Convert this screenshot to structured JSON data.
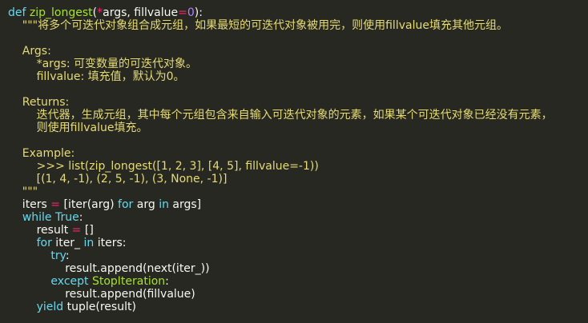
{
  "editor": {
    "background": "#272822",
    "colors": {
      "keyword": "#66d9ef",
      "function": "#a6e22e",
      "number": "#ae81ff",
      "operator": "#f92672",
      "string": "#e6db74",
      "plain": "#f8f8f2"
    },
    "lines": [
      [
        {
          "t": "def",
          "c": "kw"
        },
        {
          "t": " ",
          "c": "plain"
        },
        {
          "t": "zip_longest",
          "c": "fn"
        },
        {
          "t": "(",
          "c": "plain"
        },
        {
          "t": "*",
          "c": "op"
        },
        {
          "t": "args, fillvalue",
          "c": "plain"
        },
        {
          "t": "=",
          "c": "op"
        },
        {
          "t": "0",
          "c": "num"
        },
        {
          "t": "):",
          "c": "plain"
        }
      ],
      [
        {
          "t": "    \"\"\"将多个可迭代对象组合成元组，如果最短的可迭代对象被用完，则使用fillvalue填充其他元组。",
          "c": "str"
        }
      ],
      [],
      [
        {
          "t": "    Args:",
          "c": "str"
        }
      ],
      [
        {
          "t": "        *args: 可变数量的可迭代对象。",
          "c": "str"
        }
      ],
      [
        {
          "t": "        fillvalue: 填充值，默认为0。",
          "c": "str"
        }
      ],
      [],
      [
        {
          "t": "    Returns:",
          "c": "str"
        }
      ],
      [
        {
          "t": "        迭代器，生成元组，其中每个元组包含来自输入可迭代对象的元素，如果某个可迭代对象已经没有元素，",
          "c": "str"
        }
      ],
      [
        {
          "t": "        则使用fillvalue填充。",
          "c": "str"
        }
      ],
      [],
      [
        {
          "t": "    Example:",
          "c": "str"
        }
      ],
      [
        {
          "t": "        >>> list(zip_longest([1, 2, 3], [4, 5], fillvalue=-1))",
          "c": "str"
        }
      ],
      [
        {
          "t": "        [(1, 4, -1), (2, 5, -1), (3, None, -1)]",
          "c": "str"
        }
      ],
      [
        {
          "t": "    \"\"\"",
          "c": "str"
        }
      ],
      [
        {
          "t": "    iters ",
          "c": "plain"
        },
        {
          "t": "=",
          "c": "op"
        },
        {
          "t": " [iter(arg) ",
          "c": "plain"
        },
        {
          "t": "for",
          "c": "kw"
        },
        {
          "t": " arg ",
          "c": "plain"
        },
        {
          "t": "in",
          "c": "kw"
        },
        {
          "t": " args]",
          "c": "plain"
        }
      ],
      [
        {
          "t": "    ",
          "c": "plain"
        },
        {
          "t": "while",
          "c": "kw"
        },
        {
          "t": " ",
          "c": "plain"
        },
        {
          "t": "True",
          "c": "kw"
        },
        {
          "t": ":",
          "c": "plain"
        }
      ],
      [
        {
          "t": "        result ",
          "c": "plain"
        },
        {
          "t": "=",
          "c": "op"
        },
        {
          "t": " []",
          "c": "plain"
        }
      ],
      [
        {
          "t": "        ",
          "c": "plain"
        },
        {
          "t": "for",
          "c": "kw"
        },
        {
          "t": " iter_ ",
          "c": "plain"
        },
        {
          "t": "in",
          "c": "kw"
        },
        {
          "t": " iters:",
          "c": "plain"
        }
      ],
      [
        {
          "t": "            ",
          "c": "plain"
        },
        {
          "t": "try",
          "c": "kw"
        },
        {
          "t": ":",
          "c": "plain"
        }
      ],
      [
        {
          "t": "                result.append(next(iter_))",
          "c": "plain"
        }
      ],
      [
        {
          "t": "            ",
          "c": "plain"
        },
        {
          "t": "except",
          "c": "kw"
        },
        {
          "t": " ",
          "c": "plain"
        },
        {
          "t": "StopIteration",
          "c": "fn"
        },
        {
          "t": ":",
          "c": "plain"
        }
      ],
      [
        {
          "t": "                result.append(fillvalue)",
          "c": "plain"
        }
      ],
      [
        {
          "t": "        ",
          "c": "plain"
        },
        {
          "t": "yield",
          "c": "kw"
        },
        {
          "t": " tuple(result)",
          "c": "plain"
        }
      ]
    ]
  }
}
